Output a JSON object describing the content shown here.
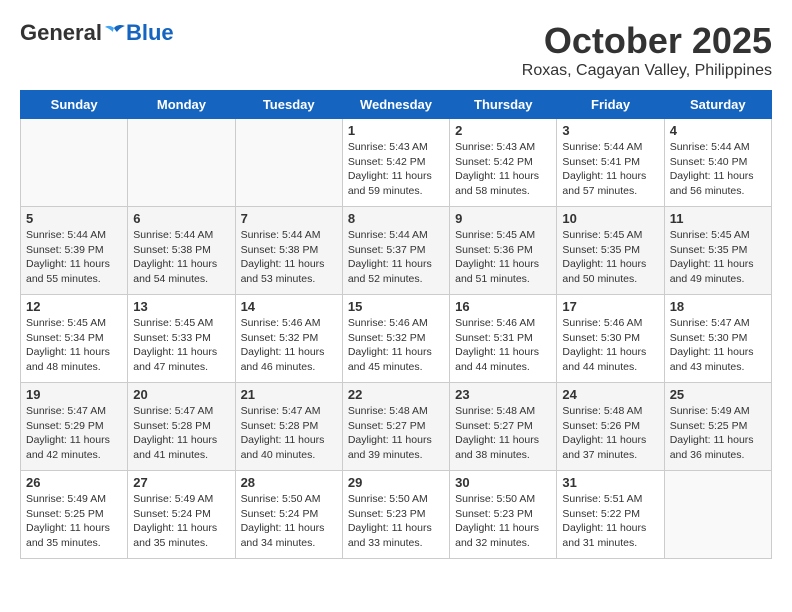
{
  "header": {
    "logo_general": "General",
    "logo_blue": "Blue",
    "month_title": "October 2025",
    "subtitle": "Roxas, Cagayan Valley, Philippines"
  },
  "days_of_week": [
    "Sunday",
    "Monday",
    "Tuesday",
    "Wednesday",
    "Thursday",
    "Friday",
    "Saturday"
  ],
  "weeks": [
    [
      {
        "day": "",
        "info": ""
      },
      {
        "day": "",
        "info": ""
      },
      {
        "day": "",
        "info": ""
      },
      {
        "day": "1",
        "info": "Sunrise: 5:43 AM\nSunset: 5:42 PM\nDaylight: 11 hours\nand 59 minutes."
      },
      {
        "day": "2",
        "info": "Sunrise: 5:43 AM\nSunset: 5:42 PM\nDaylight: 11 hours\nand 58 minutes."
      },
      {
        "day": "3",
        "info": "Sunrise: 5:44 AM\nSunset: 5:41 PM\nDaylight: 11 hours\nand 57 minutes."
      },
      {
        "day": "4",
        "info": "Sunrise: 5:44 AM\nSunset: 5:40 PM\nDaylight: 11 hours\nand 56 minutes."
      }
    ],
    [
      {
        "day": "5",
        "info": "Sunrise: 5:44 AM\nSunset: 5:39 PM\nDaylight: 11 hours\nand 55 minutes."
      },
      {
        "day": "6",
        "info": "Sunrise: 5:44 AM\nSunset: 5:38 PM\nDaylight: 11 hours\nand 54 minutes."
      },
      {
        "day": "7",
        "info": "Sunrise: 5:44 AM\nSunset: 5:38 PM\nDaylight: 11 hours\nand 53 minutes."
      },
      {
        "day": "8",
        "info": "Sunrise: 5:44 AM\nSunset: 5:37 PM\nDaylight: 11 hours\nand 52 minutes."
      },
      {
        "day": "9",
        "info": "Sunrise: 5:45 AM\nSunset: 5:36 PM\nDaylight: 11 hours\nand 51 minutes."
      },
      {
        "day": "10",
        "info": "Sunrise: 5:45 AM\nSunset: 5:35 PM\nDaylight: 11 hours\nand 50 minutes."
      },
      {
        "day": "11",
        "info": "Sunrise: 5:45 AM\nSunset: 5:35 PM\nDaylight: 11 hours\nand 49 minutes."
      }
    ],
    [
      {
        "day": "12",
        "info": "Sunrise: 5:45 AM\nSunset: 5:34 PM\nDaylight: 11 hours\nand 48 minutes."
      },
      {
        "day": "13",
        "info": "Sunrise: 5:45 AM\nSunset: 5:33 PM\nDaylight: 11 hours\nand 47 minutes."
      },
      {
        "day": "14",
        "info": "Sunrise: 5:46 AM\nSunset: 5:32 PM\nDaylight: 11 hours\nand 46 minutes."
      },
      {
        "day": "15",
        "info": "Sunrise: 5:46 AM\nSunset: 5:32 PM\nDaylight: 11 hours\nand 45 minutes."
      },
      {
        "day": "16",
        "info": "Sunrise: 5:46 AM\nSunset: 5:31 PM\nDaylight: 11 hours\nand 44 minutes."
      },
      {
        "day": "17",
        "info": "Sunrise: 5:46 AM\nSunset: 5:30 PM\nDaylight: 11 hours\nand 44 minutes."
      },
      {
        "day": "18",
        "info": "Sunrise: 5:47 AM\nSunset: 5:30 PM\nDaylight: 11 hours\nand 43 minutes."
      }
    ],
    [
      {
        "day": "19",
        "info": "Sunrise: 5:47 AM\nSunset: 5:29 PM\nDaylight: 11 hours\nand 42 minutes."
      },
      {
        "day": "20",
        "info": "Sunrise: 5:47 AM\nSunset: 5:28 PM\nDaylight: 11 hours\nand 41 minutes."
      },
      {
        "day": "21",
        "info": "Sunrise: 5:47 AM\nSunset: 5:28 PM\nDaylight: 11 hours\nand 40 minutes."
      },
      {
        "day": "22",
        "info": "Sunrise: 5:48 AM\nSunset: 5:27 PM\nDaylight: 11 hours\nand 39 minutes."
      },
      {
        "day": "23",
        "info": "Sunrise: 5:48 AM\nSunset: 5:27 PM\nDaylight: 11 hours\nand 38 minutes."
      },
      {
        "day": "24",
        "info": "Sunrise: 5:48 AM\nSunset: 5:26 PM\nDaylight: 11 hours\nand 37 minutes."
      },
      {
        "day": "25",
        "info": "Sunrise: 5:49 AM\nSunset: 5:25 PM\nDaylight: 11 hours\nand 36 minutes."
      }
    ],
    [
      {
        "day": "26",
        "info": "Sunrise: 5:49 AM\nSunset: 5:25 PM\nDaylight: 11 hours\nand 35 minutes."
      },
      {
        "day": "27",
        "info": "Sunrise: 5:49 AM\nSunset: 5:24 PM\nDaylight: 11 hours\nand 35 minutes."
      },
      {
        "day": "28",
        "info": "Sunrise: 5:50 AM\nSunset: 5:24 PM\nDaylight: 11 hours\nand 34 minutes."
      },
      {
        "day": "29",
        "info": "Sunrise: 5:50 AM\nSunset: 5:23 PM\nDaylight: 11 hours\nand 33 minutes."
      },
      {
        "day": "30",
        "info": "Sunrise: 5:50 AM\nSunset: 5:23 PM\nDaylight: 11 hours\nand 32 minutes."
      },
      {
        "day": "31",
        "info": "Sunrise: 5:51 AM\nSunset: 5:22 PM\nDaylight: 11 hours\nand 31 minutes."
      },
      {
        "day": "",
        "info": ""
      }
    ]
  ]
}
